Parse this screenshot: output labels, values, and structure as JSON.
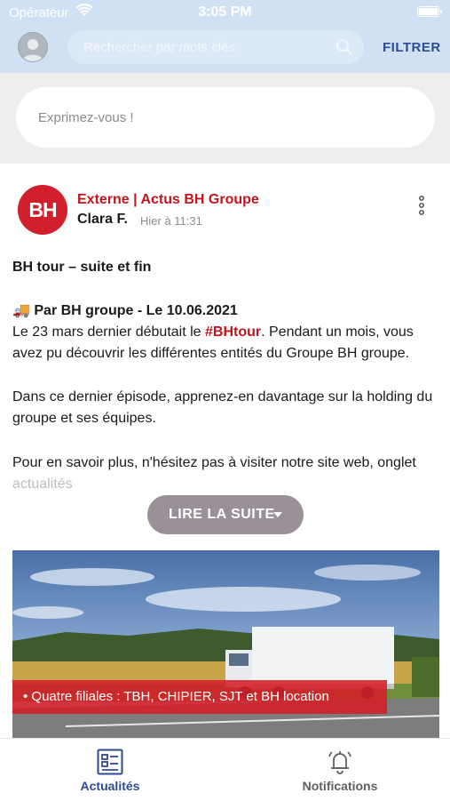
{
  "status_bar": {
    "carrier": "Opérateur",
    "time": "3:05 PM"
  },
  "header": {
    "search_placeholder": "Rechercher par mots clés",
    "filter_label": "FILTRER"
  },
  "composer": {
    "placeholder": "Exprimez-vous !"
  },
  "post": {
    "logo_text": "BH",
    "source": "Externe | Actus BH Groupe",
    "author": "Clara F.",
    "time": "Hier à 11:31",
    "title": "BH tour – suite et fin",
    "byline_emoji": "🚚",
    "byline": "Par BH groupe - Le 10.06.2021",
    "para1_start": "Le 23 mars dernier débutait le ",
    "para1_hashtag": "#BHtour",
    "para1_end": ". Pendant un mois, vous avez pu découvrir les différentes entités du Groupe BH groupe.",
    "para2": "Dans ce dernier épisode, apprenez-en davantage sur la holding du groupe et ses équipes.",
    "para3": "Pour en savoir plus, n'hésitez pas à visiter notre site web, onglet",
    "para3_cut": "actualités",
    "read_more": "LIRE LA SUITE",
    "image_caption": "• Quatre filiales : TBH, CHIPIER, SJT et BH location"
  },
  "tabbar": {
    "tabs": [
      {
        "label": "Actualités",
        "icon": "newspaper-icon",
        "active": true
      },
      {
        "label": "Notifications",
        "icon": "bell-icon",
        "active": false
      }
    ]
  },
  "colors": {
    "header_bg": "#cfe1f2",
    "brand_red": "#c0141e",
    "accent_blue": "#2e4a92",
    "button_grey": "#9a9198"
  }
}
